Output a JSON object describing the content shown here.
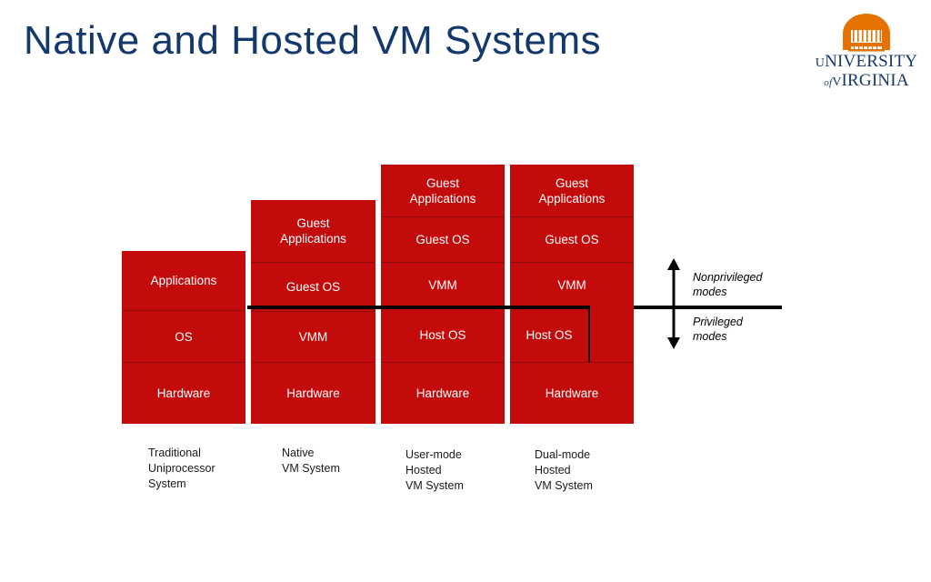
{
  "slide": {
    "title": "Native and Hosted VM Systems",
    "title_color": "#13386b",
    "background": "#ffffff"
  },
  "logo": {
    "name": "university-of-virginia-logo",
    "line1": "UNIVERSITY",
    "of": "of",
    "line2": "VIRGINIA",
    "dome_color": "#e57200",
    "text_color": "#13386b"
  },
  "diagram": {
    "box_color": "#c40b0b",
    "box_text_color": "#ffffff",
    "divider_color": "#8d0c0c",
    "boundary_color": "#000000",
    "columns": [
      {
        "id": "traditional-uniprocessor-system",
        "caption": "Traditional\nUniprocessor\nSystem",
        "layers": [
          {
            "label": "Applications"
          },
          {
            "label": "OS"
          },
          {
            "label": "Hardware"
          }
        ]
      },
      {
        "id": "native-vm-system",
        "caption": "Native\nVM System",
        "layers": [
          {
            "label": "Guest\nApplications"
          },
          {
            "label": "Guest OS"
          },
          {
            "label": "VMM"
          },
          {
            "label": "Hardware"
          }
        ]
      },
      {
        "id": "user-mode-hosted-vm-system",
        "caption": "User-mode\nHosted\nVM System",
        "layers": [
          {
            "label": "Guest\nApplications"
          },
          {
            "label": "Guest OS"
          },
          {
            "label": "VMM"
          },
          {
            "label": "Host OS"
          },
          {
            "label": "Hardware"
          }
        ]
      },
      {
        "id": "dual-mode-hosted-vm-system",
        "caption": "Dual-mode\nHosted\nVM System",
        "layers": [
          {
            "label": "Guest\nApplications"
          },
          {
            "label": "Guest OS"
          },
          {
            "label": "VMM"
          },
          {
            "label": "Host OS"
          },
          {
            "label": "Hardware"
          }
        ]
      }
    ],
    "mode_labels": {
      "nonprivileged": "Nonprivileged\nmodes",
      "privileged": "Privileged\nmodes"
    }
  }
}
